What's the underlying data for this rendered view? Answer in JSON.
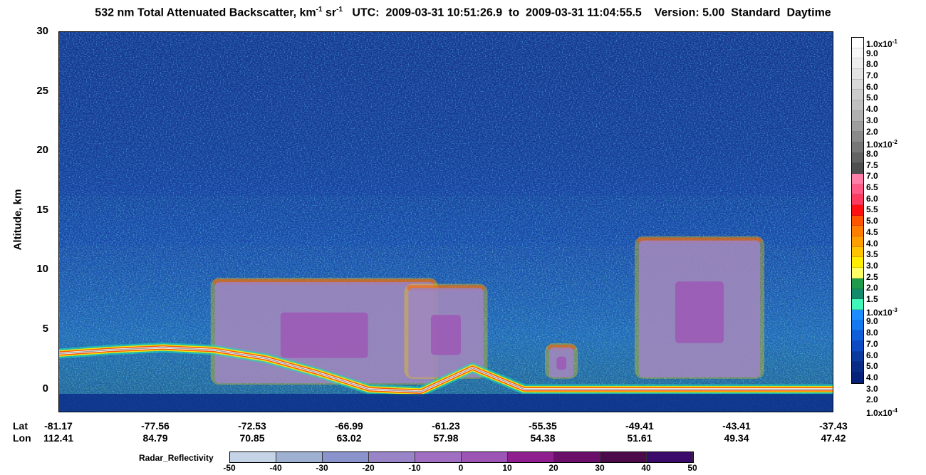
{
  "title": {
    "part1": "532 nm Total Attenuated Backscatter, km",
    "sup1": "-1",
    "part2": " sr",
    "sup2": "-1",
    "part3": "   UTC:  2009-03-31 10:51:26.9  to  2009-03-31 11:04:55.5    Version: 5.00  Standard  Daytime"
  },
  "chart_data": {
    "type": "heatmap",
    "ylabel": "Altitude, km",
    "ylim": [
      -2,
      30
    ],
    "yticks": [
      "30",
      "25",
      "20",
      "15",
      "10",
      "5",
      "0"
    ],
    "lat_label": "Lat",
    "lon_label": "Lon",
    "x_lat": [
      "-81.17",
      "-77.56",
      "-72.53",
      "-66.99",
      "-61.23",
      "-55.35",
      "-49.41",
      "-43.41",
      "-37.43"
    ],
    "x_lon": [
      "112.41",
      "84.79",
      "70.85",
      "63.02",
      "57.98",
      "54.38",
      "51.61",
      "49.34",
      "47.42"
    ],
    "surface_altitude_km": [
      3.0,
      3.3,
      3.5,
      3.3,
      2.6,
      1.4,
      0.0,
      -0.2,
      1.8,
      0.0,
      0.0,
      0.0,
      0.0,
      0.0,
      0.0,
      0.0
    ],
    "lidar_cloud_regions": [
      {
        "x_from": "-74.5",
        "x_to": "-62.0",
        "top_km": 9.0,
        "base_km": 0.5
      },
      {
        "x_from": "-63.5",
        "x_to": "-59.0",
        "top_km": 8.5,
        "base_km": 1.0
      },
      {
        "x_from": "-55.0",
        "x_to": "-53.5",
        "top_km": 3.5,
        "base_km": 1.0
      },
      {
        "x_from": "-49.5",
        "x_to": "-42.0",
        "top_km": 12.5,
        "base_km": 1.0
      }
    ],
    "radar_label": "Radar_Reflectivity",
    "radar_ticks": [
      "-50",
      "-40",
      "-30",
      "-20",
      "-10",
      "0",
      "10",
      "20",
      "30",
      "40",
      "50"
    ]
  },
  "colorbar": {
    "colors": [
      "#ffffff",
      "#f7f7f7",
      "#eeeeee",
      "#e3e3e3",
      "#d8d8d8",
      "#cccccc",
      "#c0c0c0",
      "#b0b0b0",
      "#9e9e9e",
      "#8a8a8a",
      "#777777",
      "#636363",
      "#4f4f4f",
      "#ff7fa8",
      "#ff5b86",
      "#ff3a5f",
      "#ff1010",
      "#ff5500",
      "#ff7e00",
      "#ff9e00",
      "#ffc400",
      "#ffee00",
      "#ffff66",
      "#1f9a4a",
      "#128a6c",
      "#3ff7b8",
      "#1d8cff",
      "#1478f0",
      "#0f5fdc",
      "#0c4bc4",
      "#0a3a9e",
      "#082c86",
      "#06217a"
    ],
    "labels": [
      {
        "m": "1.0x10",
        "e": "-1"
      },
      {
        "m": "9.0"
      },
      {
        "m": "8.0"
      },
      {
        "m": "7.0"
      },
      {
        "m": "6.0"
      },
      {
        "m": "5.0"
      },
      {
        "m": "4.0"
      },
      {
        "m": "3.0"
      },
      {
        "m": "2.0"
      },
      {
        "m": "1.0x10",
        "e": "-2"
      },
      {
        "m": "8.0"
      },
      {
        "m": "7.5"
      },
      {
        "m": "7.0"
      },
      {
        "m": "6.5"
      },
      {
        "m": "6.0"
      },
      {
        "m": "5.5"
      },
      {
        "m": "5.0"
      },
      {
        "m": "4.5"
      },
      {
        "m": "4.0"
      },
      {
        "m": "3.5"
      },
      {
        "m": "3.0"
      },
      {
        "m": "2.5"
      },
      {
        "m": "2.0"
      },
      {
        "m": "1.5"
      },
      {
        "m": "1.0x10",
        "e": "-3"
      },
      {
        "m": "9.0"
      },
      {
        "m": "8.0"
      },
      {
        "m": "7.0"
      },
      {
        "m": "6.0"
      },
      {
        "m": "5.0"
      },
      {
        "m": "4.0"
      },
      {
        "m": "3.0"
      },
      {
        "m": "2.0"
      },
      {
        "m": "1.0x10",
        "e": "-4"
      }
    ]
  },
  "radar_colors": [
    "#c4d3e6",
    "#9fb1d3",
    "#8b93cc",
    "#9a84c8",
    "#a06fc1",
    "#9d55b5",
    "#8f1f8e",
    "#6b0f6b",
    "#4d0a4a",
    "#3c0a6b"
  ]
}
